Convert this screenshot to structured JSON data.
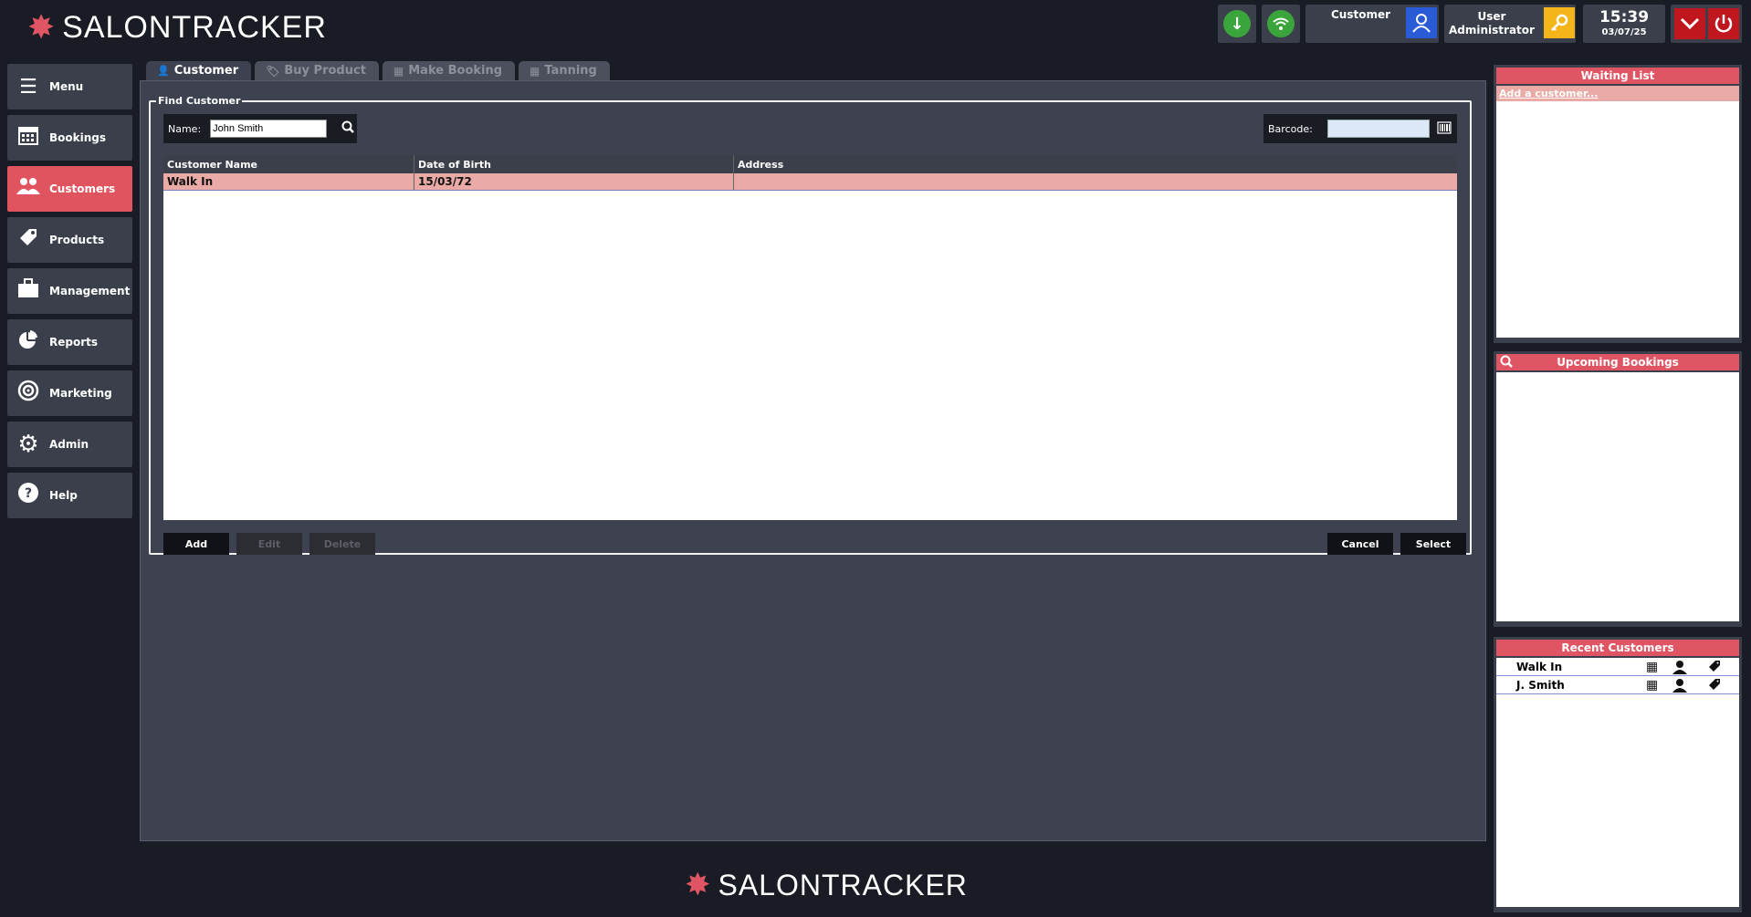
{
  "app": {
    "logo_bold": "SALON",
    "logo_light": "TRACKER"
  },
  "header": {
    "customer_label": "Customer",
    "user_label": "User",
    "user_name": "Administrator",
    "time": "15:39",
    "date": "03/07/25",
    "colors": {
      "accent": "#e05563",
      "online_green": "#3aa53a",
      "user_blue": "#2a5bd7",
      "key_yellow": "#f3b51a",
      "alert_red": "#c0161e"
    }
  },
  "sidebar": {
    "items": [
      {
        "label": "Menu",
        "icon": "hamburger-icon",
        "active": false
      },
      {
        "label": "Bookings",
        "icon": "calendar-icon",
        "active": false
      },
      {
        "label": "Customers",
        "icon": "people-icon",
        "active": true
      },
      {
        "label": "Products",
        "icon": "tag-icon",
        "active": false
      },
      {
        "label": "Management",
        "icon": "briefcase-icon",
        "active": false
      },
      {
        "label": "Reports",
        "icon": "pie-chart-icon",
        "active": false
      },
      {
        "label": "Marketing",
        "icon": "target-icon",
        "active": false
      },
      {
        "label": "Admin",
        "icon": "gear-icon",
        "active": false
      },
      {
        "label": "Help",
        "icon": "help-icon",
        "active": false
      }
    ]
  },
  "tabs": [
    {
      "label": "Customer",
      "active": true
    },
    {
      "label": "Buy Product",
      "active": false
    },
    {
      "label": "Make Booking",
      "active": false
    },
    {
      "label": "Tanning",
      "active": false
    }
  ],
  "find": {
    "legend": "Find Customer",
    "name_label": "Name:",
    "name_value": "John Smith",
    "barcode_label": "Barcode:",
    "barcode_value": ""
  },
  "table": {
    "columns": [
      "Customer Name",
      "Date of Birth",
      "Address"
    ],
    "rows": [
      {
        "name": "Walk In",
        "dob": "15/03/72",
        "address": ""
      }
    ]
  },
  "buttons": {
    "add": "Add",
    "edit": "Edit",
    "delete": "Delete",
    "cancel": "Cancel",
    "select": "Select"
  },
  "waiting_list": {
    "title": "Waiting List",
    "add_link": "Add a customer..."
  },
  "upcoming": {
    "title": "Upcoming Bookings"
  },
  "recent": {
    "title": "Recent Customers",
    "items": [
      {
        "name": "Walk In"
      },
      {
        "name": "J. Smith"
      }
    ]
  }
}
